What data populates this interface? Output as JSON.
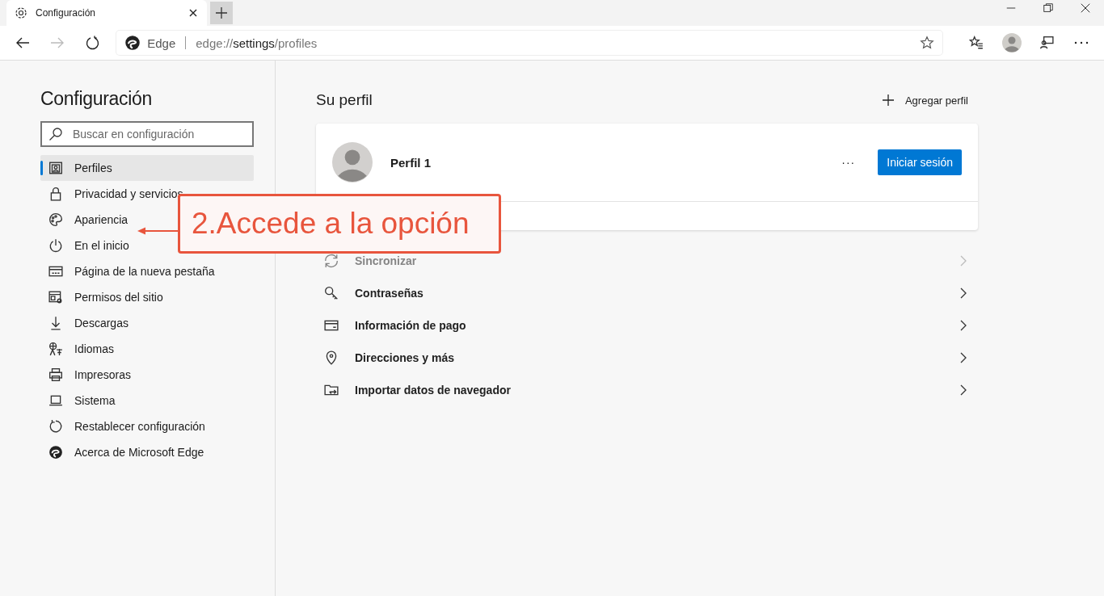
{
  "tab": {
    "title": "Configuración",
    "selected": true
  },
  "address": {
    "brand": "Edge",
    "url_prefix": "edge://",
    "url_host": "settings",
    "url_path": "/profiles"
  },
  "sidebar": {
    "title": "Configuración",
    "search": {
      "placeholder": "Buscar en configuración"
    },
    "items": [
      {
        "label": "Perfiles",
        "selected": true
      },
      {
        "label": "Privacidad y servicios",
        "selected": false
      },
      {
        "label": "Apariencia",
        "selected": false
      },
      {
        "label": "En el inicio",
        "selected": false
      },
      {
        "label": "Página de la nueva pestaña",
        "selected": false
      },
      {
        "label": "Permisos del sitio",
        "selected": false
      },
      {
        "label": "Descargas",
        "selected": false
      },
      {
        "label": "Idiomas",
        "selected": false
      },
      {
        "label": "Impresoras",
        "selected": false
      },
      {
        "label": "Sistema",
        "selected": false
      },
      {
        "label": "Restablecer configuración",
        "selected": false
      },
      {
        "label": "Acerca de Microsoft Edge",
        "selected": false
      }
    ]
  },
  "main": {
    "title": "Su perfil",
    "add_profile": "Agregar perfil",
    "profile": {
      "name": "Perfil 1",
      "more": "···",
      "sign_in": "Iniciar sesión"
    },
    "rows": [
      {
        "label": "Sincronizar",
        "disabled": true
      },
      {
        "label": "Contraseñas",
        "disabled": false
      },
      {
        "label": "Información de pago",
        "disabled": false
      },
      {
        "label": "Direcciones y más",
        "disabled": false
      },
      {
        "label": "Importar datos de navegador",
        "disabled": false
      }
    ]
  },
  "annotation": {
    "text": "2.Accede a la opción"
  }
}
